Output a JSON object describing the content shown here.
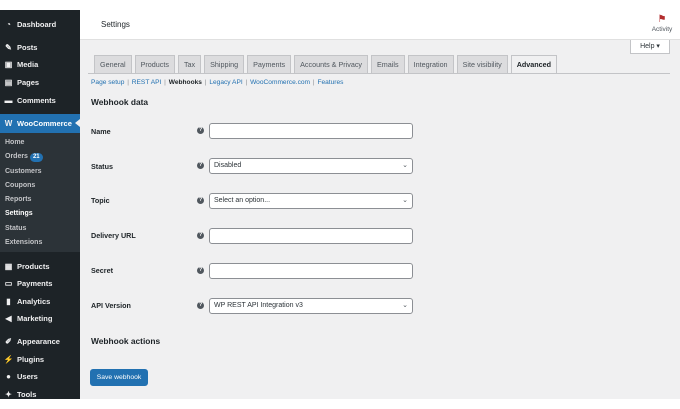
{
  "sidebar": {
    "items": [
      {
        "label": "Dashboard",
        "icon": "dashboard-icon"
      },
      {
        "label": "Posts",
        "icon": "pin-icon"
      },
      {
        "label": "Media",
        "icon": "media-icon"
      },
      {
        "label": "Pages",
        "icon": "page-icon"
      },
      {
        "label": "Comments",
        "icon": "comment-icon"
      }
    ],
    "woocommerce": {
      "label": "WooCommerce",
      "icon": "woo-icon"
    },
    "submenu": [
      {
        "label": "Home"
      },
      {
        "label": "Orders",
        "badge": "21"
      },
      {
        "label": "Customers"
      },
      {
        "label": "Coupons"
      },
      {
        "label": "Reports"
      },
      {
        "label": "Settings"
      },
      {
        "label": "Status"
      },
      {
        "label": "Extensions"
      }
    ],
    "items2": [
      {
        "label": "Products",
        "icon": "box-icon"
      },
      {
        "label": "Payments",
        "icon": "card-icon"
      },
      {
        "label": "Analytics",
        "icon": "bar-chart-icon"
      },
      {
        "label": "Marketing",
        "icon": "megaphone-icon"
      }
    ],
    "items3": [
      {
        "label": "Appearance",
        "icon": "brush-icon"
      },
      {
        "label": "Plugins",
        "icon": "plug-icon"
      },
      {
        "label": "Users",
        "icon": "user-icon"
      },
      {
        "label": "Tools",
        "icon": "wrench-icon"
      }
    ]
  },
  "header": {
    "title": "Settings",
    "activity_label": "Activity",
    "help_label": "Help ▾"
  },
  "tabs": [
    {
      "label": "General"
    },
    {
      "label": "Products"
    },
    {
      "label": "Tax"
    },
    {
      "label": "Shipping"
    },
    {
      "label": "Payments"
    },
    {
      "label": "Accounts & Privacy"
    },
    {
      "label": "Emails"
    },
    {
      "label": "Integration"
    },
    {
      "label": "Site visibility"
    },
    {
      "label": "Advanced",
      "active": true
    }
  ],
  "subsections": [
    {
      "label": "Page setup"
    },
    {
      "label": "REST API"
    },
    {
      "label": "Webhooks",
      "current": true
    },
    {
      "label": "Legacy API"
    },
    {
      "label": "WooCommerce.com"
    },
    {
      "label": "Features"
    }
  ],
  "form": {
    "heading": "Webhook data",
    "fields": {
      "name": {
        "label": "Name",
        "value": ""
      },
      "status": {
        "label": "Status",
        "value": "Disabled"
      },
      "topic": {
        "label": "Topic",
        "value": "Select an option..."
      },
      "delivery_url": {
        "label": "Delivery URL",
        "value": ""
      },
      "secret": {
        "label": "Secret",
        "value": ""
      },
      "api_version": {
        "label": "API Version",
        "value": "WP REST API Integration v3"
      }
    },
    "actions_heading": "Webhook actions",
    "save_label": "Save webhook"
  },
  "colors": {
    "sidebar_bg": "#1d2327",
    "accent": "#2271b1",
    "content_bg": "#f0f0f1"
  }
}
